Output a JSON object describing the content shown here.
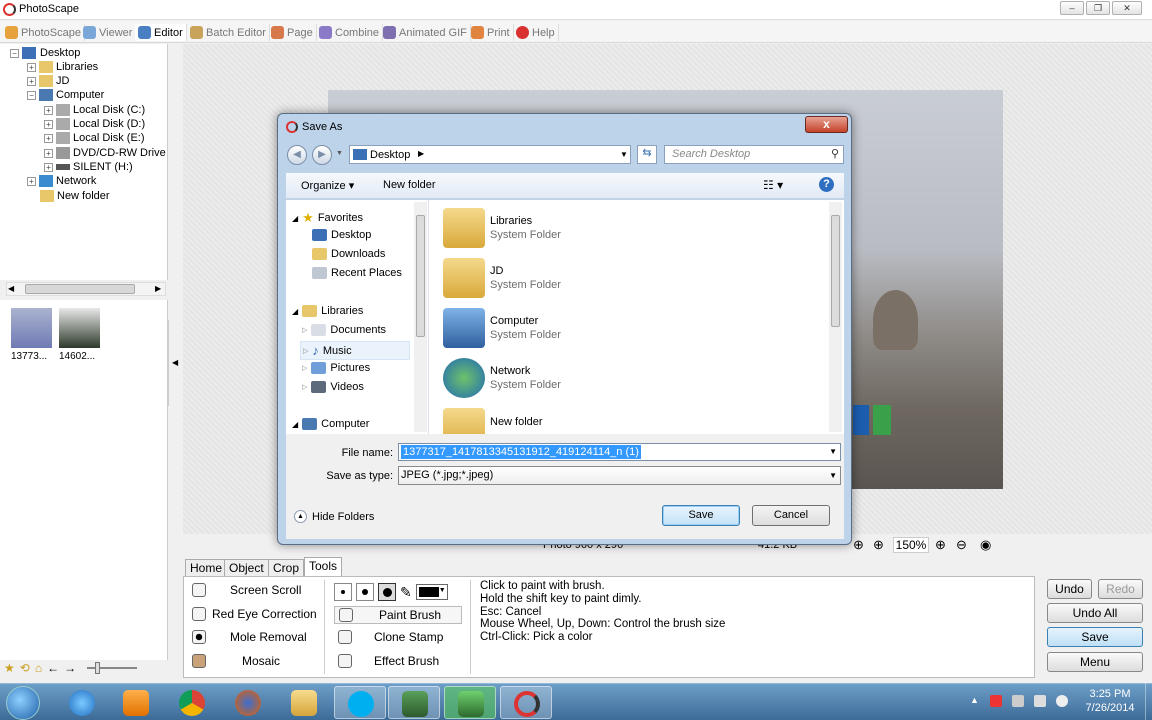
{
  "app": {
    "title": "PhotoScape"
  },
  "menu_tabs": [
    {
      "label": "PhotoScape",
      "icon": "photoscape-icon"
    },
    {
      "label": "Viewer",
      "icon": "viewer-icon"
    },
    {
      "label": "Editor",
      "icon": "editor-icon",
      "active": true
    },
    {
      "label": "Batch Editor",
      "icon": "batch-editor-icon"
    },
    {
      "label": "Page",
      "icon": "page-icon"
    },
    {
      "label": "Combine",
      "icon": "combine-icon"
    },
    {
      "label": "Animated GIF",
      "icon": "animated-gif-icon"
    },
    {
      "label": "Print",
      "icon": "print-icon"
    },
    {
      "label": "Help",
      "icon": "help-icon"
    }
  ],
  "tree": {
    "root": "Desktop",
    "items": [
      "Libraries",
      "JD",
      "Computer",
      "Local Disk (C:)",
      "Local Disk (D:)",
      "Local Disk (E:)",
      "DVD/CD-RW Drive",
      "SILENT (H:)",
      "Network",
      "New folder"
    ]
  },
  "thumbs": [
    "13773...",
    "14602..."
  ],
  "status": {
    "photo_info": "Photo 960 x 296",
    "file_size": "41.2 KB",
    "zoom": "150%"
  },
  "tool_tabs": [
    "Home",
    "Object",
    "Crop",
    "Tools"
  ],
  "tools": {
    "left": [
      "Screen Scroll",
      "Red Eye Correction",
      "Mole Removal",
      "Mosaic"
    ],
    "mid": [
      "Paint Brush",
      "Clone Stamp",
      "Effect Brush"
    ],
    "help_lines": [
      "Click to paint with brush.",
      "Hold the shift key to paint dimly.",
      "Esc: Cancel",
      "Mouse Wheel, Up, Down: Control the brush size",
      "Ctrl-Click: Pick a color"
    ]
  },
  "right_buttons": {
    "undo": "Undo",
    "redo": "Redo",
    "undo_all": "Undo All",
    "save": "Save",
    "menu": "Menu"
  },
  "dialog": {
    "title": "Save As",
    "close": "x",
    "location": "Desktop",
    "search_placeholder": "Search Desktop",
    "organize": "Organize",
    "new_folder": "New folder",
    "nav": {
      "favorites": "Favorites",
      "favorites_items": [
        "Desktop",
        "Downloads",
        "Recent Places"
      ],
      "libraries": "Libraries",
      "libraries_items": [
        "Documents",
        "Music",
        "Pictures",
        "Videos"
      ],
      "computer": "Computer"
    },
    "files": [
      {
        "name": "Libraries",
        "type": "System Folder"
      },
      {
        "name": "JD",
        "type": "System Folder"
      },
      {
        "name": "Computer",
        "type": "System Folder"
      },
      {
        "name": "Network",
        "type": "System Folder"
      },
      {
        "name": "New folder",
        "type": ""
      }
    ],
    "file_name_label": "File name:",
    "file_name": "1377317_1417813345131912_419124114_n (1)",
    "save_type_label": "Save as type:",
    "save_type": "JPEG (*.jpg;*.jpeg)",
    "hide_folders": "Hide Folders",
    "save": "Save",
    "cancel": "Cancel"
  },
  "clock": {
    "time": "3:25 PM",
    "date": "7/26/2014"
  }
}
